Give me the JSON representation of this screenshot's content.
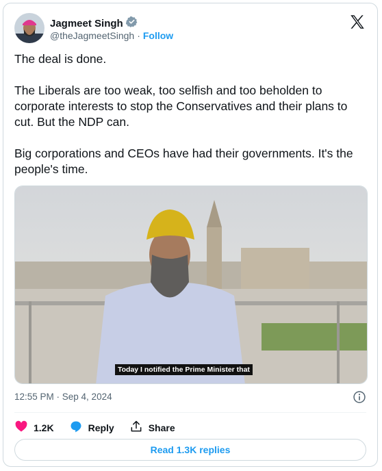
{
  "author": {
    "name": "Jagmeet Singh",
    "handle": "@theJagmeetSingh",
    "separator": "·",
    "follow_label": "Follow"
  },
  "tweet": {
    "paragraphs": [
      "The deal is done.",
      "The Liberals are too weak, too selfish and too beholden to corporate interests to stop the Conservatives and their plans to cut. But the NDP can.",
      "Big corporations and CEOs have had their governments. It's the people's time."
    ],
    "media_caption": "Today I notified the Prime Minister that",
    "timestamp": "12:55 PM · Sep 4, 2024"
  },
  "actions": {
    "like_count": "1.2K",
    "reply_label": "Reply",
    "share_label": "Share",
    "read_replies_label": "Read 1.3K replies"
  },
  "icons": {
    "verified": "verified-badge-icon",
    "logo": "x-logo-icon",
    "info": "info-icon",
    "like": "heart-icon",
    "reply": "speech-bubble-icon",
    "share": "share-upload-icon"
  },
  "colors": {
    "accent": "#1d9bf0",
    "like": "#f91880",
    "muted": "#536471",
    "text": "#0f1419"
  }
}
